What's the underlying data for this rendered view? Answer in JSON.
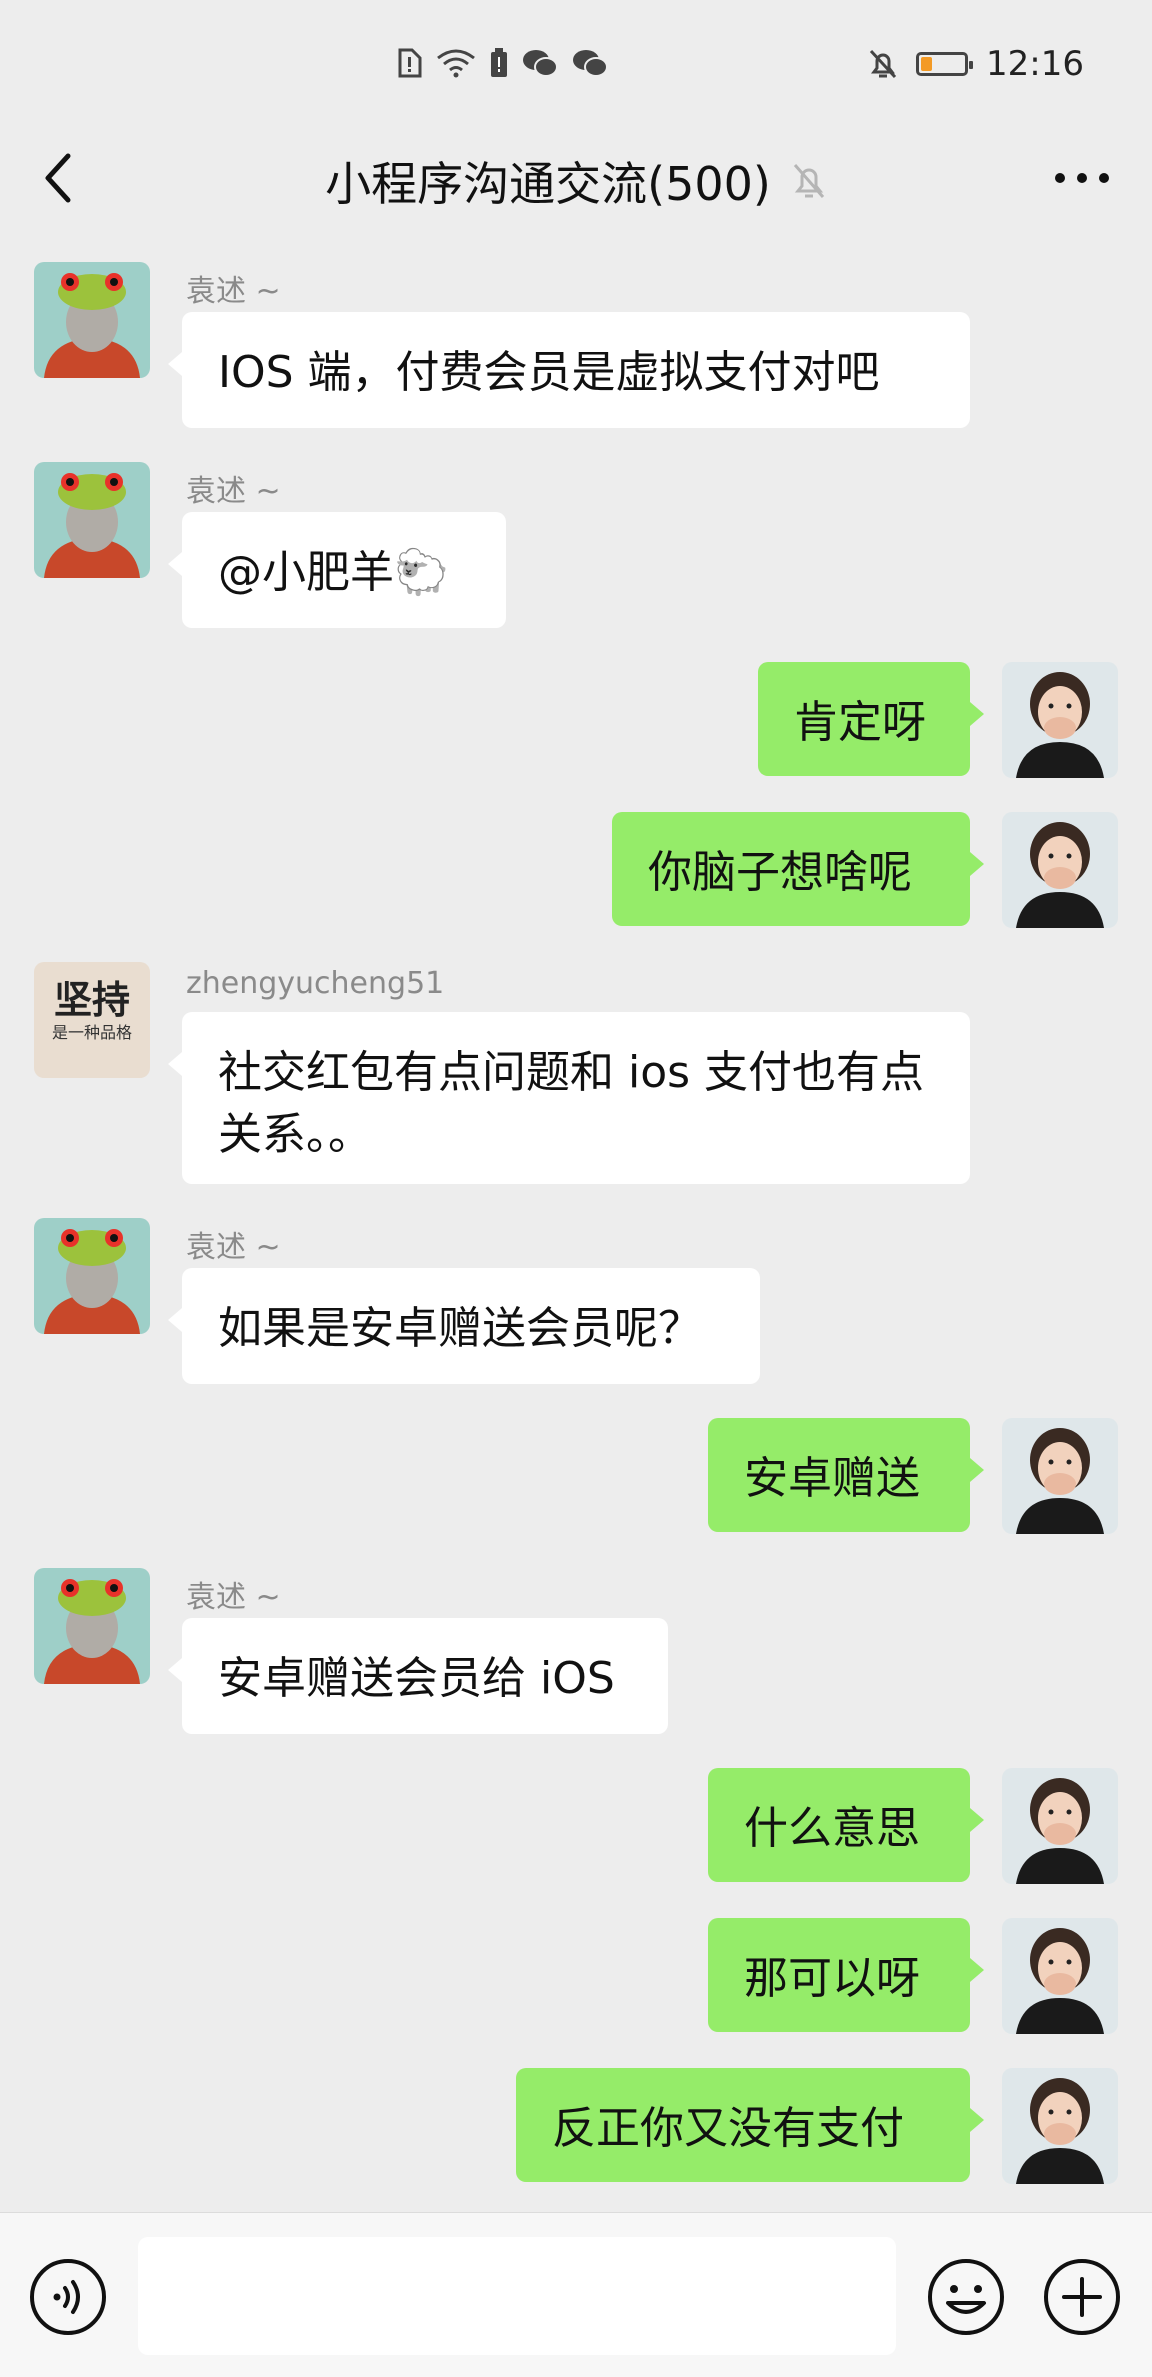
{
  "status_bar": {
    "time": "12:16",
    "icons": [
      "sim-alert-icon",
      "wifi-icon",
      "battery-saver-icon",
      "wechat-notification-icon",
      "wechat-notification-icon",
      "mute-icon"
    ],
    "battery_level": 0.25,
    "battery_color": "#f39a25"
  },
  "header": {
    "title": "小程序沟通交流(500)",
    "muted_icon": "bell-off-icon",
    "back_icon": "chevron-left-icon",
    "more_icon": "more-dots-icon"
  },
  "contacts": {
    "yuanshu": "袁述 ~",
    "zheng": "zhengyucheng51",
    "zheng_avatar_line1": "坚持",
    "zheng_avatar_line2": "是一种品格"
  },
  "messages": [
    {
      "from": "yuanshu",
      "side": "in",
      "text": "IOS 端，付费会员是虚拟支付对吧"
    },
    {
      "from": "yuanshu",
      "side": "in",
      "text": "@小肥羊🐑"
    },
    {
      "from": "me",
      "side": "out",
      "text": "肯定呀"
    },
    {
      "from": "me",
      "side": "out",
      "text": "你脑子想啥呢"
    },
    {
      "from": "zheng",
      "side": "in",
      "text": "社交红包有点问题和 ios 支付也有点关系。。"
    },
    {
      "from": "yuanshu",
      "side": "in",
      "text": "如果是安卓赠送会员呢？"
    },
    {
      "from": "me",
      "side": "out",
      "text": "安卓赠送"
    },
    {
      "from": "yuanshu",
      "side": "in",
      "text": "安卓赠送会员给 iOS"
    },
    {
      "from": "me",
      "side": "out",
      "text": "什么意思"
    },
    {
      "from": "me",
      "side": "out",
      "text": "那可以呀"
    },
    {
      "from": "me",
      "side": "out",
      "text": "反正你又没有支付"
    }
  ],
  "input_bar": {
    "voice_icon": "voice-icon",
    "input_value": "",
    "emoji_icon": "emoji-icon",
    "plus_icon": "plus-icon"
  },
  "colors": {
    "background": "#ededed",
    "outgoing_bubble": "#95ec69",
    "incoming_bubble": "#ffffff"
  }
}
